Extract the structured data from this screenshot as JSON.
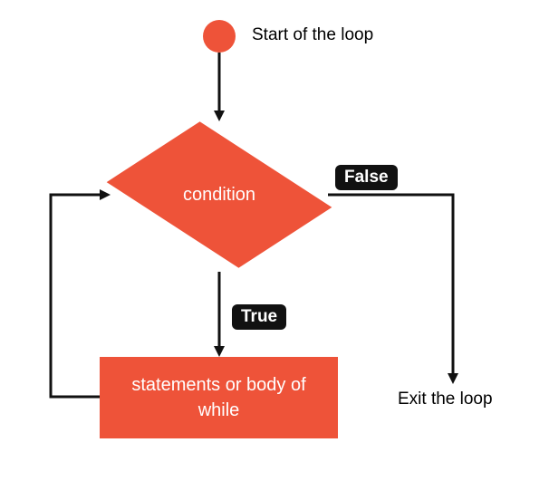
{
  "start_label": "Start of the loop",
  "condition_text": "condition",
  "true_label": "True",
  "false_label": "False",
  "body_text": "statements or body of while",
  "exit_label": "Exit the loop",
  "colors": {
    "accent": "#ee5339",
    "badge_bg": "#111111"
  }
}
